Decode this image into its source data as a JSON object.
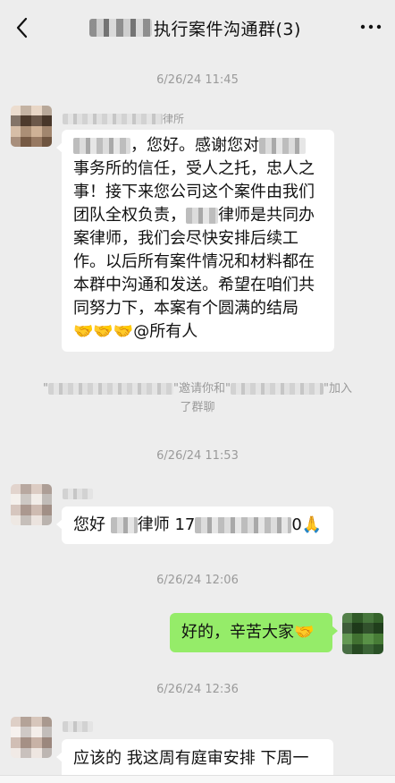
{
  "header": {
    "title": "执行案件沟通群(3)",
    "back_icon": "chevron-left-icon",
    "more_icon": "more-dots-icon"
  },
  "messages": [
    {
      "time": "6/26/24 11:45",
      "sender_suffix": "律所",
      "lines": [
        "，您好。感谢您对",
        "事务所的信任，受人之托，忠人之",
        "事！接下来您公司这个案件由我们",
        "团队全权负责，",
        "律师是共同办",
        "案律师，我们会尽快安排后续工",
        "作。以后所有案件情况和材料都在",
        "本群中沟通和发送。希望在咱们共",
        "同努力下，本案有个圆满的结局",
        "🤝🤝🤝@所有人"
      ]
    },
    {
      "system_notice": {
        "part1": "\"",
        "part2": "\"邀请你和\"",
        "part3": "\"加入",
        "part4": "了群聊"
      }
    },
    {
      "time": "6/26/24 11:53",
      "text_a": "您好",
      "text_b": "律师 17",
      "text_c": "0🙏"
    },
    {
      "time": "6/26/24 12:06",
      "text": "好的，辛苦大家🤝"
    },
    {
      "time": "6/26/24 12:36",
      "text": "应该的 我这周有庭审安排 下周一"
    }
  ],
  "colors": {
    "background": "#ededed",
    "bubble_other": "#ffffff",
    "bubble_self": "#95ec69",
    "meta_text": "#9a9a9a"
  }
}
